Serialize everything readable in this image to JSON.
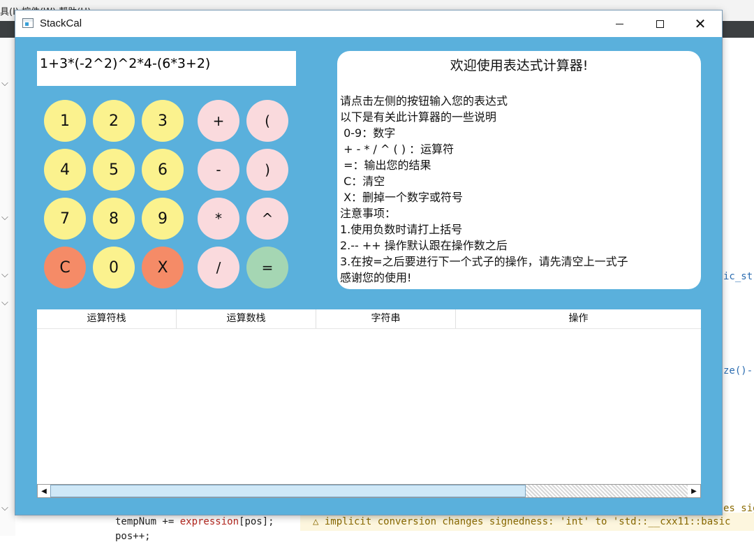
{
  "background": {
    "menu_text": "具(I)   控件(W)   帮助(H)",
    "code_right_1": "ic_str",
    "code_right_2": "ze()-",
    "code_line_1": "tempNum += ",
    "code_line_1_var": "expression",
    "code_line_1_rest": "[pos];",
    "warning": "△ implicit conversion changes signedness: 'int' to 'std::__cxx11::basic",
    "warning_right": "es sig",
    "code_line_2": "pos++;"
  },
  "window": {
    "title": "StackCal",
    "minimize": "minimize",
    "maximize": "maximize",
    "close": "✕"
  },
  "display": {
    "expression": "1+3*(-2^2)^2*4-(6*3+2)"
  },
  "keypad": {
    "k1": "1",
    "k2": "2",
    "k3": "3",
    "plus": "+",
    "lparen": "(",
    "k4": "4",
    "k5": "5",
    "k6": "6",
    "minus": "-",
    "rparen": ")",
    "k7": "7",
    "k8": "8",
    "k9": "9",
    "mul": "*",
    "pow": "^",
    "clear": "C",
    "k0": "0",
    "del": "X",
    "div": "/",
    "eq": "="
  },
  "info": {
    "title": "欢迎使用表达式计算器!",
    "lines": [
      "请点击左侧的按钮输入您的表达式",
      "以下是有关此计算器的一些说明",
      " 0-9：数字",
      " + - * / ^ ( ) ：运算符",
      " =：输出您的结果",
      " C：清空",
      " X：删掉一个数字或符号",
      "注意事项：",
      "1.使用负数时请打上括号",
      "2.-- ++ 操作默认跟在操作数之后",
      "3.在按=之后要进行下一个式子的操作，请先清空上一式子",
      "感谢您的使用!"
    ]
  },
  "table": {
    "headers": [
      "运算符栈",
      "运算数栈",
      "字符串",
      "操作"
    ]
  },
  "colors": {
    "window_bg": "#5ab0dc",
    "number_key": "#fbf28e",
    "operator_key": "#fadadd",
    "danger_key": "#f58b67",
    "equals_key": "#a5d6b3"
  }
}
